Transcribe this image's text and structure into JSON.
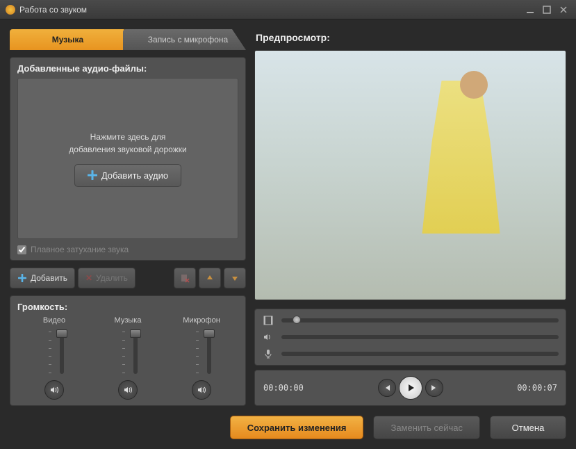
{
  "window": {
    "title": "Работа со звуком"
  },
  "tabs": {
    "music": "Музыка",
    "record": "Запись с микрофона"
  },
  "audio_panel": {
    "title": "Добавленные аудио-файлы:",
    "hint_l1": "Нажмите здесь для",
    "hint_l2": "добавления звуковой дорожки",
    "add_btn": "Добавить аудио",
    "fade_label": "Плавное затухание звука"
  },
  "toolbar": {
    "add": "Добавить",
    "delete": "Удалить"
  },
  "volume": {
    "title": "Громкость:",
    "video": "Видео",
    "music": "Музыка",
    "mic": "Микрофон"
  },
  "preview": {
    "title": "Предпросмотр:",
    "time_start": "00:00:00",
    "time_end": "00:00:07"
  },
  "bottom": {
    "save": "Сохранить изменения",
    "replace": "Заменить сейчас",
    "cancel": "Отмена"
  }
}
